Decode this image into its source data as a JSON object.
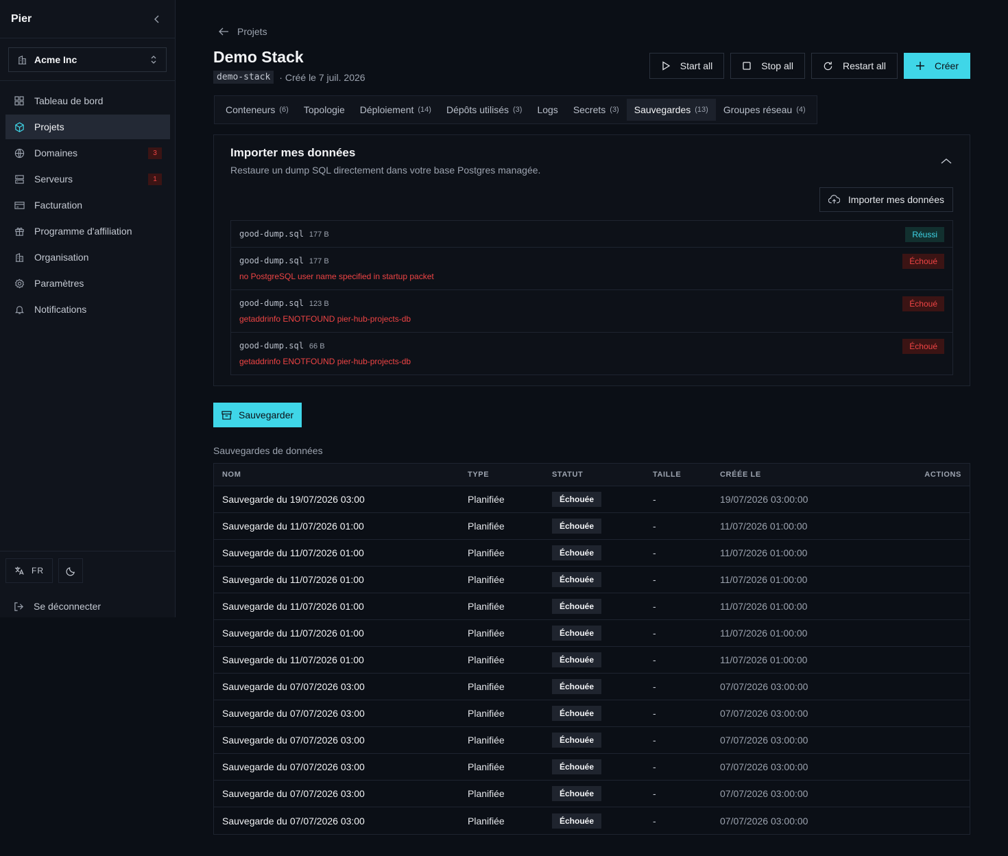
{
  "sidebar": {
    "brand": "Pier",
    "org": "Acme Inc",
    "items": [
      {
        "label": "Tableau de bord",
        "icon": "dashboard-icon"
      },
      {
        "label": "Projets",
        "icon": "cube-icon",
        "active": true
      },
      {
        "label": "Domaines",
        "icon": "globe-icon",
        "badge": "3"
      },
      {
        "label": "Serveurs",
        "icon": "server-icon",
        "badge": "1"
      },
      {
        "label": "Facturation",
        "icon": "credit-card-icon"
      },
      {
        "label": "Programme d'affiliation",
        "icon": "gift-icon"
      },
      {
        "label": "Organisation",
        "icon": "building-icon"
      },
      {
        "label": "Paramètres",
        "icon": "gear-icon"
      },
      {
        "label": "Notifications",
        "icon": "bell-icon"
      }
    ],
    "lang": "FR",
    "logout": "Se déconnecter"
  },
  "header": {
    "breadcrumb": "Projets",
    "title": "Demo Stack",
    "slug": "demo-stack",
    "created": "· Créé le 7 juil. 2026",
    "actions": {
      "start": "Start all",
      "stop": "Stop all",
      "restart": "Restart all",
      "create": "Créer"
    }
  },
  "tabs": [
    {
      "label": "Conteneurs",
      "count": "(6)"
    },
    {
      "label": "Topologie",
      "count": ""
    },
    {
      "label": "Déploiement",
      "count": "(14)"
    },
    {
      "label": "Dépôts utilisés",
      "count": "(3)"
    },
    {
      "label": "Logs",
      "count": ""
    },
    {
      "label": "Secrets",
      "count": "(3)"
    },
    {
      "label": "Sauvegardes",
      "count": "(13)",
      "active": true
    },
    {
      "label": "Groupes réseau",
      "count": "(4)"
    }
  ],
  "import": {
    "title": "Importer mes données",
    "description": "Restaure un dump SQL directement dans votre base Postgres managée.",
    "button": "Importer mes données",
    "items": [
      {
        "file": "good-dump.sql",
        "size": "177 B",
        "status": "Réussi",
        "ok": true,
        "error": ""
      },
      {
        "file": "good-dump.sql",
        "size": "177 B",
        "status": "Échoué",
        "ok": false,
        "error": "no PostgreSQL user name specified in startup packet"
      },
      {
        "file": "good-dump.sql",
        "size": "123 B",
        "status": "Échoué",
        "ok": false,
        "error": "getaddrinfo ENOTFOUND pier-hub-projects-db"
      },
      {
        "file": "good-dump.sql",
        "size": "66 B",
        "status": "Échoué",
        "ok": false,
        "error": "getaddrinfo ENOTFOUND pier-hub-projects-db"
      }
    ]
  },
  "backups": {
    "save_label": "Sauvegarder",
    "section_label": "Sauvegardes de données",
    "columns": {
      "name": "NOM",
      "type": "TYPE",
      "status": "STATUT",
      "size": "TAILLE",
      "created": "CRÉÉE LE",
      "actions": "ACTIONS"
    },
    "rows": [
      {
        "name": "Sauvegarde du 19/07/2026 03:00",
        "type": "Planifiée",
        "status": "Échouée",
        "size": "-",
        "created": "19/07/2026 03:00:00"
      },
      {
        "name": "Sauvegarde du 11/07/2026 01:00",
        "type": "Planifiée",
        "status": "Échouée",
        "size": "-",
        "created": "11/07/2026 01:00:00"
      },
      {
        "name": "Sauvegarde du 11/07/2026 01:00",
        "type": "Planifiée",
        "status": "Échouée",
        "size": "-",
        "created": "11/07/2026 01:00:00"
      },
      {
        "name": "Sauvegarde du 11/07/2026 01:00",
        "type": "Planifiée",
        "status": "Échouée",
        "size": "-",
        "created": "11/07/2026 01:00:00"
      },
      {
        "name": "Sauvegarde du 11/07/2026 01:00",
        "type": "Planifiée",
        "status": "Échouée",
        "size": "-",
        "created": "11/07/2026 01:00:00"
      },
      {
        "name": "Sauvegarde du 11/07/2026 01:00",
        "type": "Planifiée",
        "status": "Échouée",
        "size": "-",
        "created": "11/07/2026 01:00:00"
      },
      {
        "name": "Sauvegarde du 11/07/2026 01:00",
        "type": "Planifiée",
        "status": "Échouée",
        "size": "-",
        "created": "11/07/2026 01:00:00"
      },
      {
        "name": "Sauvegarde du 07/07/2026 03:00",
        "type": "Planifiée",
        "status": "Échouée",
        "size": "-",
        "created": "07/07/2026 03:00:00"
      },
      {
        "name": "Sauvegarde du 07/07/2026 03:00",
        "type": "Planifiée",
        "status": "Échouée",
        "size": "-",
        "created": "07/07/2026 03:00:00"
      },
      {
        "name": "Sauvegarde du 07/07/2026 03:00",
        "type": "Planifiée",
        "status": "Échouée",
        "size": "-",
        "created": "07/07/2026 03:00:00"
      },
      {
        "name": "Sauvegarde du 07/07/2026 03:00",
        "type": "Planifiée",
        "status": "Échouée",
        "size": "-",
        "created": "07/07/2026 03:00:00"
      },
      {
        "name": "Sauvegarde du 07/07/2026 03:00",
        "type": "Planifiée",
        "status": "Échouée",
        "size": "-",
        "created": "07/07/2026 03:00:00"
      },
      {
        "name": "Sauvegarde du 07/07/2026 03:00",
        "type": "Planifiée",
        "status": "Échouée",
        "size": "-",
        "created": "07/07/2026 03:00:00"
      }
    ]
  },
  "colors": {
    "accent": "#3fd6e8",
    "danger": "#ef4444",
    "background": "#0b0f16"
  }
}
